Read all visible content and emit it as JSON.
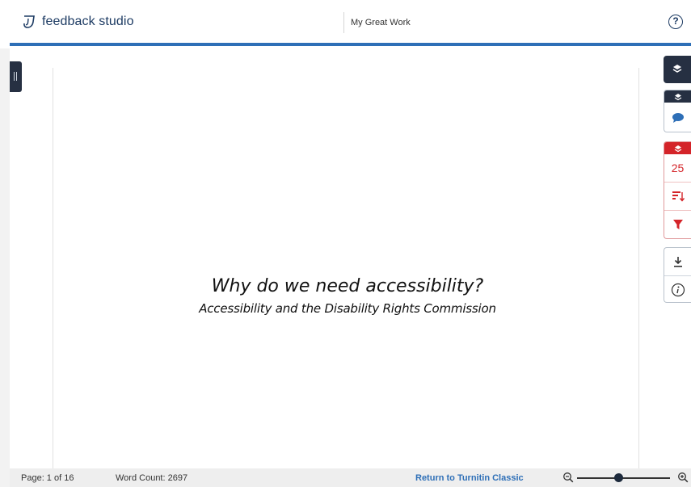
{
  "header": {
    "logo_text": "feedback studio",
    "document_title": "My Great Work",
    "help_glyph": "?"
  },
  "document": {
    "heading": "Why do we need accessibility?",
    "subheading": "Accessibility and the Disability Rights Commission"
  },
  "toolbar": {
    "similarity_count": "25",
    "icons": [
      "layers-icon",
      "comment-icon",
      "sort-icon",
      "filter-icon",
      "download-icon",
      "info-icon"
    ]
  },
  "footer": {
    "page": "Page: 1 of 16",
    "word_count": "Word Count: 2697",
    "return_link": "Return to Turnitin Classic",
    "zoom_level": 0.45
  },
  "colors": {
    "brand_blue": "#2e6fb7",
    "dark_navy": "#263042",
    "alert_red": "#d42429"
  }
}
